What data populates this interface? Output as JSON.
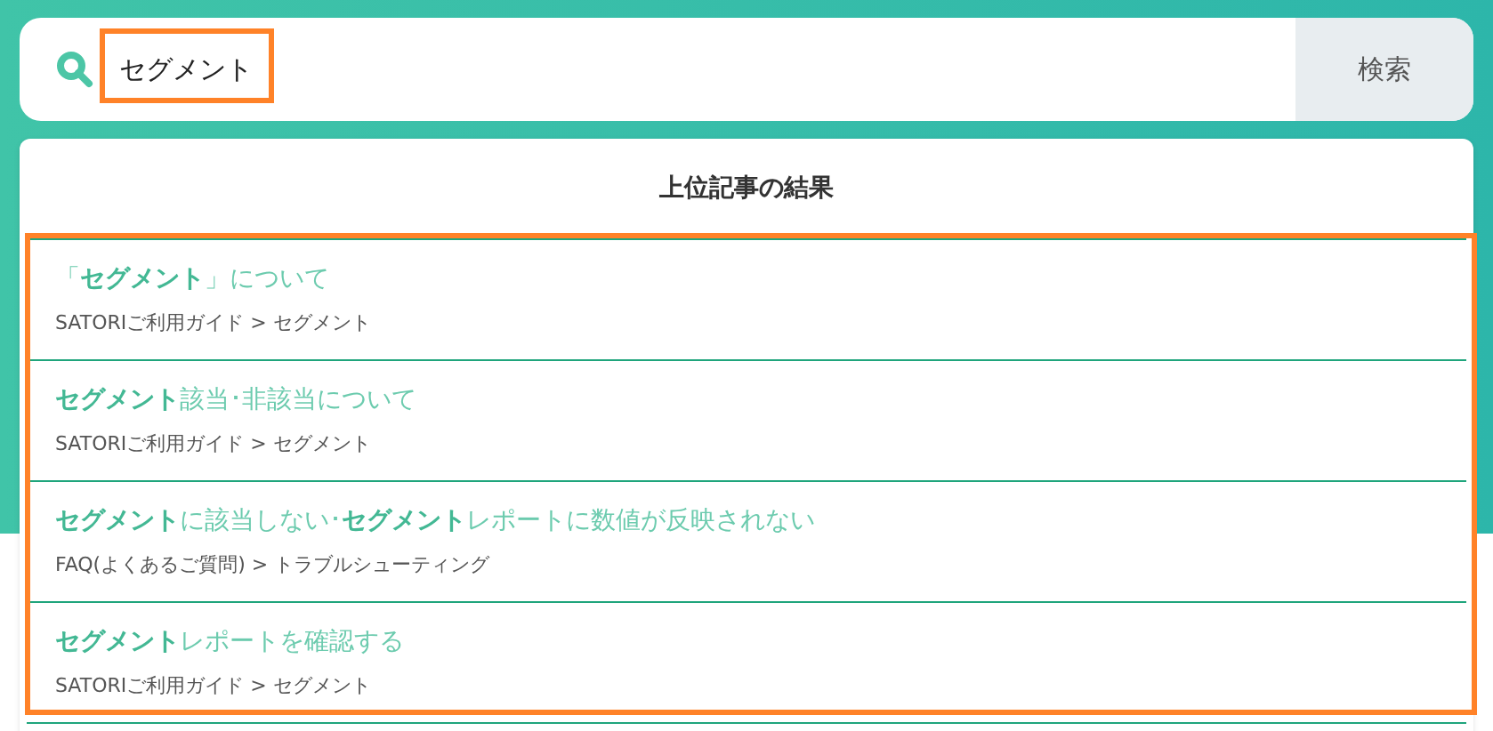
{
  "search": {
    "value": "セグメント",
    "button": "検索"
  },
  "results": {
    "heading": "上位記事の結果",
    "items": [
      {
        "title": "「**セグメント**」について",
        "path": "SATORIご利用ガイド > セグメント"
      },
      {
        "title": "**セグメント**該当･非該当について",
        "path": "SATORIご利用ガイド > セグメント"
      },
      {
        "title": "**セグメント**に該当しない･**セグメント**レポートに数値が反映されない",
        "path": "FAQ(よくあるご質問) > トラブルシューティング"
      },
      {
        "title": "**セグメント**レポートを確認する",
        "path": "SATORIご利用ガイド > セグメント"
      }
    ]
  }
}
